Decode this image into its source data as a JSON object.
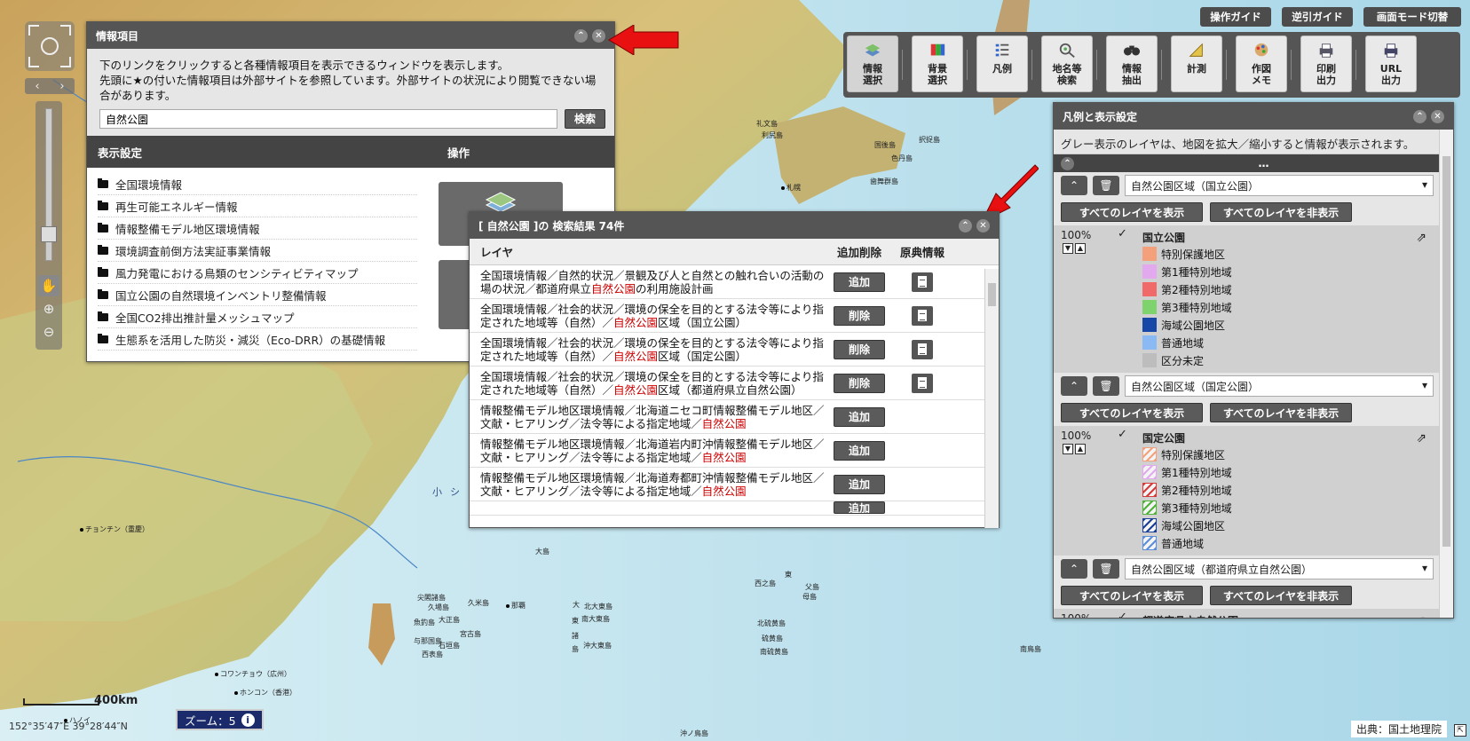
{
  "map": {
    "places": [
      {
        "name": "札幌",
        "dot": true
      },
      {
        "name": "礼文島",
        "dot": false
      },
      {
        "name": "利尻島",
        "dot": false
      },
      {
        "name": "国後島",
        "dot": false
      },
      {
        "name": "択捉島",
        "dot": false
      },
      {
        "name": "歯舞群島",
        "dot": false
      },
      {
        "name": "色丹島",
        "dot": false
      },
      {
        "name": "チョンチン（重慶）",
        "dot": true
      },
      {
        "name": "コワンチョウ（広州）",
        "dot": true
      },
      {
        "name": "ホンコン（香港）",
        "dot": true
      },
      {
        "name": "那覇",
        "dot": true
      },
      {
        "name": "尖閣諸島",
        "dot": false
      },
      {
        "name": "久場島",
        "dot": false
      },
      {
        "name": "久米島",
        "dot": false
      },
      {
        "name": "魚釣島",
        "dot": false
      },
      {
        "name": "大正島",
        "dot": false
      },
      {
        "name": "宮古島",
        "dot": false
      },
      {
        "name": "与那国島",
        "dot": false
      },
      {
        "name": "石垣島",
        "dot": false
      },
      {
        "name": "西表島",
        "dot": false
      },
      {
        "name": "北大東島",
        "dot": false
      },
      {
        "name": "南大東島",
        "dot": false
      },
      {
        "name": "沖大東島",
        "dot": false
      },
      {
        "name": "西之島",
        "dot": false
      },
      {
        "name": "父島",
        "dot": false
      },
      {
        "name": "母島",
        "dot": false
      },
      {
        "name": "北硫黄島",
        "dot": false
      },
      {
        "name": "硫黄島",
        "dot": false
      },
      {
        "name": "南硫黄島",
        "dot": false
      },
      {
        "name": "南鳥島",
        "dot": false
      },
      {
        "name": "沖ノ鳥島",
        "dot": false
      },
      {
        "name": "大島",
        "dot": false
      },
      {
        "name": "小",
        "dot": false
      },
      {
        "name": "東",
        "dot": false
      },
      {
        "name": "シ",
        "dot": false
      },
      {
        "name": "東",
        "dot": false
      },
      {
        "name": "大",
        "dot": false
      },
      {
        "name": "諸",
        "dot": false
      },
      {
        "name": "島",
        "dot": false
      },
      {
        "name": "ハノイ",
        "dot": true
      }
    ],
    "scale_label": "400km",
    "coords": "152°35′47″E 39°28′44″N",
    "zoom_label": "ズーム：5",
    "credit": "出典：国土地理院"
  },
  "guides": [
    "操作ガイド",
    "逆引ガイド",
    "画面モード切替"
  ],
  "toolbar": [
    {
      "label1": "情報",
      "label2": "選択",
      "icon": "layers-icon",
      "active": true
    },
    {
      "label1": "背景",
      "label2": "選択",
      "icon": "palette-icon",
      "active": false
    },
    {
      "label1": "凡例",
      "label2": "",
      "icon": "legend-icon",
      "active": false
    },
    {
      "label1": "地名等",
      "label2": "検索",
      "icon": "search-place-icon",
      "active": false
    },
    {
      "label1": "情報",
      "label2": "抽出",
      "icon": "binoculars-icon",
      "active": false
    },
    {
      "label1": "計測",
      "label2": "",
      "icon": "ruler-icon",
      "active": false
    },
    {
      "label1": "作図",
      "label2": "メモ",
      "icon": "draw-icon",
      "active": false
    },
    {
      "label1": "印刷",
      "label2": "出力",
      "icon": "print-icon",
      "active": false
    },
    {
      "label1": "URL",
      "label2": "出力",
      "icon": "url-print-icon",
      "active": false
    }
  ],
  "info_panel": {
    "title": "情報項目",
    "desc1": "下のリンクをクリックすると各種情報項目を表示できるウィンドウを表示します。",
    "desc2": "先頭に★の付いた情報項目は外部サイトを参照しています。外部サイトの状況により閲覧できない場合があります。",
    "search_value": "自然公園",
    "search_btn": "検索",
    "col_display": "表示設定",
    "col_op": "操作",
    "items": [
      "全国環境情報",
      "再生可能エネルギー情報",
      "情報整備モデル地区環境情報",
      "環境調査前倒方法実証事業情報",
      "風力発電における鳥類のセンシティビティマップ",
      "国立公園の自然環境インベントリ整備情報",
      "全国CO2排出推計量メッシュマップ",
      "生態系を活用した防災・減災（Eco-DRR）の基礎情報"
    ]
  },
  "results_panel": {
    "title": "[ 自然公園 ]の 検索結果 74件",
    "col_layer": "レイヤ",
    "col_op": "追加削除",
    "col_src": "原典情報",
    "rows": [
      {
        "pre": "全国環境情報／自然的状況／景観及び人と自然との触れ合いの活動の場の状況／都道府県立",
        "hl": "自然公園",
        "post": "の利用施設計画",
        "op": "追加",
        "doc": true
      },
      {
        "pre": "全国環境情報／社会的状況／環境の保全を目的とする法令等により指定された地域等（自然）／",
        "hl": "自然公園",
        "post": "区域（国立公園）",
        "op": "削除",
        "doc": true
      },
      {
        "pre": "全国環境情報／社会的状況／環境の保全を目的とする法令等により指定された地域等（自然）／",
        "hl": "自然公園",
        "post": "区域（国定公園）",
        "op": "削除",
        "doc": true
      },
      {
        "pre": "全国環境情報／社会的状況／環境の保全を目的とする法令等により指定された地域等（自然）／",
        "hl": "自然公園",
        "post": "区域（都道府県立自然公園）",
        "op": "削除",
        "doc": true
      },
      {
        "pre": "情報整備モデル地区環境情報／北海道ニセコ町情報整備モデル地区／文献・ヒアリング／法令等による指定地域／",
        "hl": "自然公園",
        "post": "",
        "op": "追加",
        "doc": false
      },
      {
        "pre": "情報整備モデル地区環境情報／北海道岩内町沖情報整備モデル地区／文献・ヒアリング／法令等による指定地域／",
        "hl": "自然公園",
        "post": "",
        "op": "追加",
        "doc": false
      },
      {
        "pre": "情報整備モデル地区環境情報／北海道寿都町沖情報整備モデル地区／文献・ヒアリング／法令等による指定地域／",
        "hl": "自然公園",
        "post": "",
        "op": "追加",
        "doc": false
      }
    ],
    "partial_op": "追加"
  },
  "legend_panel": {
    "title": "凡例と表示設定",
    "note": "グレー表示のレイヤは、地図を拡大／縮小すると情報が表示されます。",
    "ellipsis": "…",
    "show_all": "すべてのレイヤを表示",
    "hide_all": "すべてのレイヤを非表示",
    "groups": [
      {
        "select": "自然公園区域（国立公園）",
        "pct": "100%",
        "name": "国立公園",
        "items": [
          {
            "label": "特別保護地区",
            "color": "#f4a07a",
            "hatch": false
          },
          {
            "label": "第1種特別地域",
            "color": "#e3a9ef",
            "hatch": false
          },
          {
            "label": "第2種特別地域",
            "color": "#f06a6a",
            "hatch": false
          },
          {
            "label": "第3種特別地域",
            "color": "#7ed36d",
            "hatch": false
          },
          {
            "label": "海域公園地区",
            "color": "#1748a8",
            "hatch": false
          },
          {
            "label": "普通地域",
            "color": "#8ab9f3",
            "hatch": false
          },
          {
            "label": "区分未定",
            "color": "#bdbdbd",
            "hatch": false
          }
        ]
      },
      {
        "select": "自然公園区域（国定公園）",
        "pct": "100%",
        "name": "国定公園",
        "items": [
          {
            "label": "特別保護地区",
            "color": "#f4a07a",
            "hatch": true
          },
          {
            "label": "第1種特別地域",
            "color": "#e3a9ef",
            "hatch": true
          },
          {
            "label": "第2種特別地域",
            "color": "#d63a3a",
            "hatch": true
          },
          {
            "label": "第3種特別地域",
            "color": "#4fb33a",
            "hatch": true
          },
          {
            "label": "海域公園地区",
            "color": "#1a3f9a",
            "hatch": true
          },
          {
            "label": "普通地域",
            "color": "#5b8fdc",
            "hatch": true
          }
        ]
      },
      {
        "select": "自然公園区域（都道府県立自然公園）",
        "pct": "100%",
        "name": "都道府県立自然公園",
        "items": []
      }
    ]
  }
}
